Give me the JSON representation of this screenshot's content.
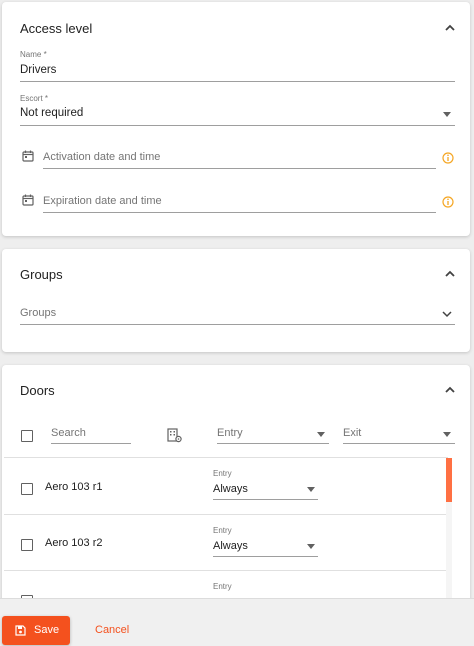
{
  "access_level": {
    "title": "Access level",
    "name_label": "Name *",
    "name_value": "Drivers",
    "escort_label": "Escort *",
    "escort_value": "Not required",
    "activation_placeholder": "Activation date and time",
    "expiration_placeholder": "Expiration date and time"
  },
  "groups": {
    "title": "Groups",
    "placeholder": "Groups"
  },
  "doors": {
    "title": "Doors",
    "search_placeholder": "Search",
    "entry_filter": "Entry",
    "exit_filter": "Exit",
    "rows": [
      {
        "name": "Aero 103 r1",
        "entry_label": "Entry",
        "entry_value": "Always"
      },
      {
        "name": "Aero 103 r2",
        "entry_label": "Entry",
        "entry_value": "Always"
      },
      {
        "name": "",
        "entry_label": "Entry",
        "entry_value": ""
      }
    ]
  },
  "footer": {
    "save_label": "Save",
    "cancel_label": "Cancel"
  },
  "colors": {
    "accent": "#f4511e",
    "warning_icon": "#f5a623",
    "scrollbar": "#ff7043"
  }
}
